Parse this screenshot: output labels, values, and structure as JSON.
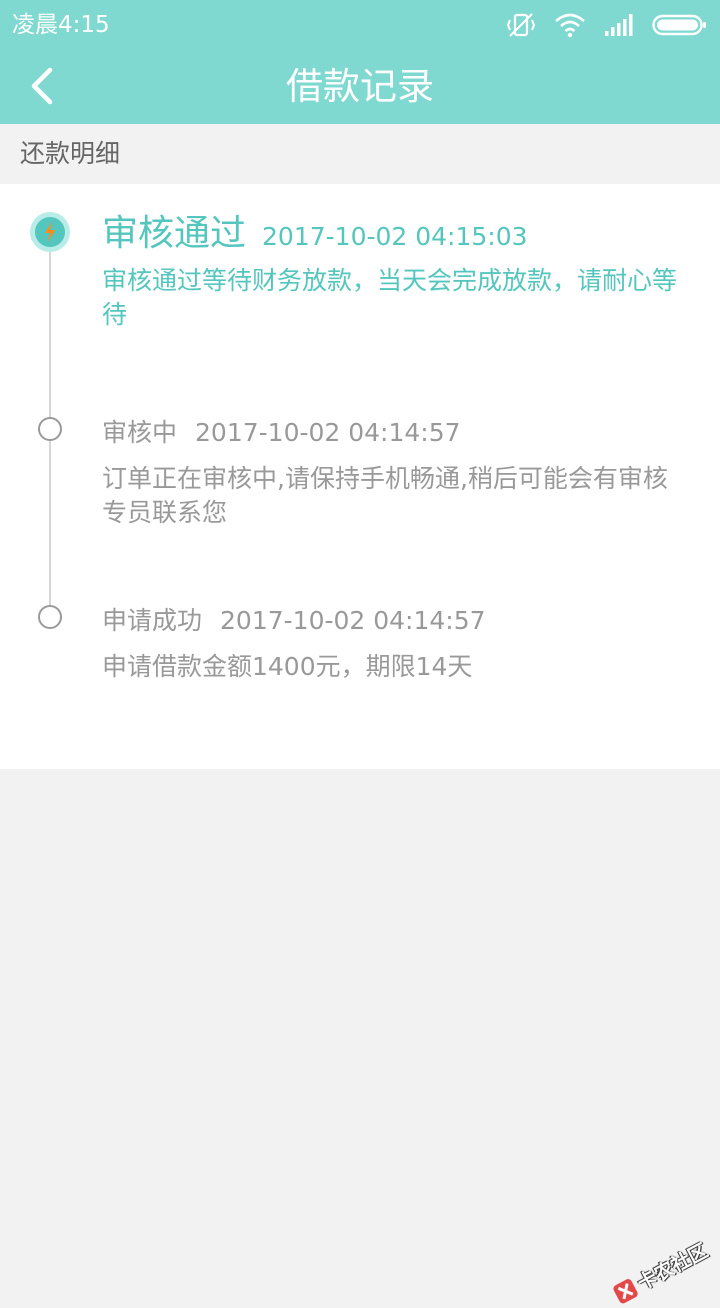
{
  "status_bar": {
    "time": "凌晨4:15",
    "icons": [
      "vibrate-off-icon",
      "wifi-icon",
      "signal-icon",
      "battery-icon"
    ]
  },
  "nav": {
    "back_icon": "chevron-left-icon",
    "title": "借款记录"
  },
  "section": {
    "title": "还款明细"
  },
  "timeline": {
    "items": [
      {
        "status": "审核通过",
        "time": "2017-10-02 04:15:03",
        "description": "审核通过等待财务放款，当天会完成放款，请耐心等待",
        "active": true,
        "icon": "lightning-icon"
      },
      {
        "status": "审核中",
        "time": "2017-10-02 04:14:57",
        "description": "订单正在审核中,请保持手机畅通,稍后可能会有审核专员联系您",
        "active": false
      },
      {
        "status": "申请成功",
        "time": "2017-10-02 04:14:57",
        "description": "申请借款金额1400元，期限14天",
        "active": false
      }
    ]
  },
  "watermark": {
    "text": "卡农社区"
  },
  "colors": {
    "accent": "#7fd9d0",
    "active_text": "#54c6bd",
    "inactive_text": "#999999",
    "background": "#f2f2f2"
  }
}
